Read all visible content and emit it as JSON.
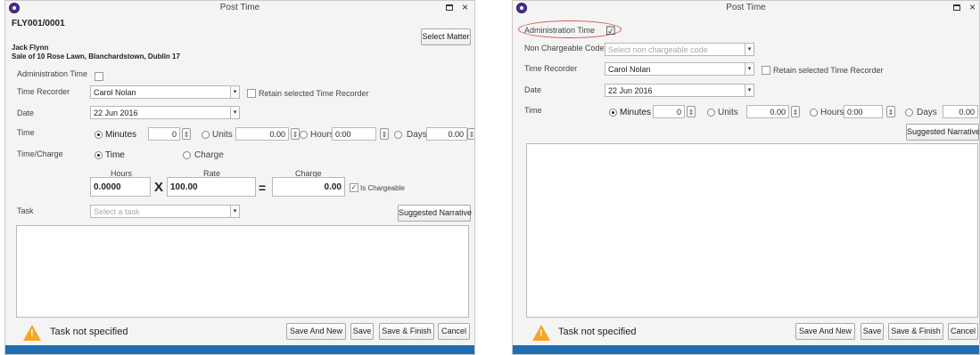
{
  "left": {
    "title": "Post Time",
    "matter_ref": "FLY001/0001",
    "client_name": "Jack Flynn",
    "matter_desc": "Sale of 10 Rose Lawn, Blanchardstown, Dublin 17",
    "select_matter": "Select Matter",
    "admin_time_label": "Administration Time",
    "time_recorder_label": "Time Recorder",
    "time_recorder_value": "Carol Nolan",
    "retain_label": "Retain selected Time Recorder",
    "date_label": "Date",
    "date_value": "22 Jun 2016",
    "time_label": "Time",
    "minutes_label": "Minutes",
    "minutes_value": "0",
    "units_label": "Units",
    "units_value": "0.00",
    "hours_label": "Hours",
    "hours_value": "0:00",
    "days_label": "Days",
    "days_value": "0.00",
    "time_charge_label": "Time/Charge",
    "opt_time": "Time",
    "opt_charge": "Charge",
    "col_hours": "Hours",
    "col_rate": "Rate",
    "col_charge": "Charge",
    "hours_amount": "0.0000",
    "rate_amount": "100.00",
    "charge_amount": "0.00",
    "times_sign": "X",
    "equals_sign": "=",
    "is_chargeable": "Is Chargeable",
    "task_label": "Task",
    "task_placeholder": "Select a task",
    "suggested_narrative": "Suggested Narrative",
    "warning": "Task not specified",
    "save_and_new": "Save And New",
    "save": "Save",
    "save_finish": "Save & Finish",
    "cancel": "Cancel"
  },
  "right": {
    "title": "Post Time",
    "admin_time_label": "Administration Time",
    "admin_time_checked": "☑",
    "non_chargeable_label": "Non Chargeable Code",
    "non_chargeable_placeholder": "Select non chargeable code",
    "time_recorder_label": "Time Recorder",
    "time_recorder_value": "Carol Nolan",
    "retain_label": "Retain selected Time Recorder",
    "date_label": "Date",
    "date_value": "22 Jun 2016",
    "time_label": "Time",
    "minutes_label": "Minutes",
    "minutes_value": "0",
    "units_label": "Units",
    "units_value": "0.00",
    "hours_label": "Hours",
    "hours_value": "0:00",
    "days_label": "Days",
    "days_value": "0.00",
    "suggested_narrative": "Suggested Narrative",
    "warning": "Task not specified",
    "save_and_new": "Save And New",
    "save": "Save",
    "save_finish": "Save & Finish",
    "cancel": "Cancel"
  },
  "icons": {
    "combo_arrow": "▾",
    "spin": "⇕",
    "close": "×",
    "warning_mark": "!"
  },
  "colors": {
    "status_bar": "#1f6fb5",
    "warning": "#f5a623",
    "highlight": "#d9534f"
  }
}
